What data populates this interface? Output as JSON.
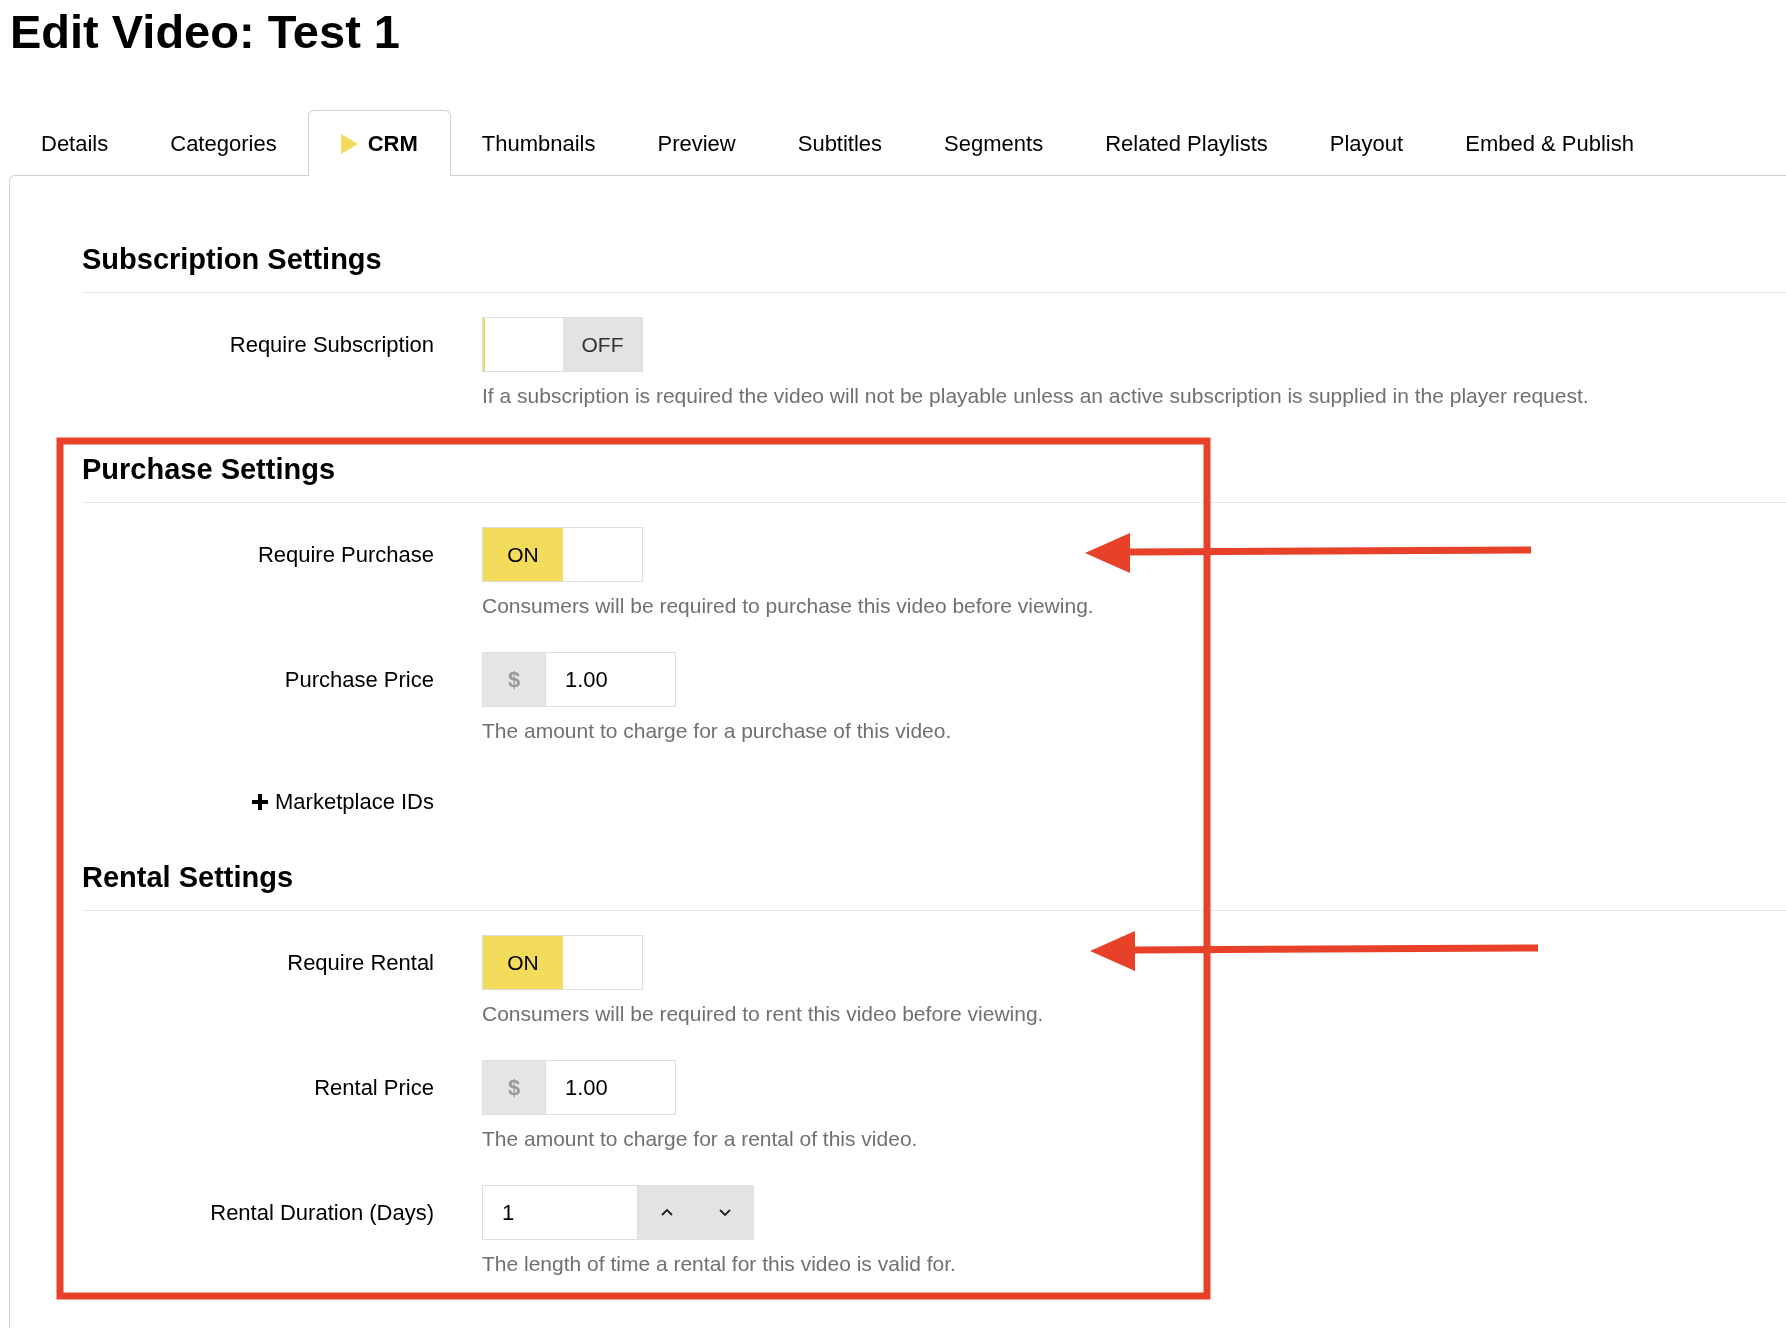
{
  "page_title": "Edit Video: Test 1",
  "tabs": [
    {
      "label": "Details",
      "selected": false
    },
    {
      "label": "Categories",
      "selected": false
    },
    {
      "label": "CRM",
      "selected": true
    },
    {
      "label": "Thumbnails",
      "selected": false
    },
    {
      "label": "Preview",
      "selected": false
    },
    {
      "label": "Subtitles",
      "selected": false
    },
    {
      "label": "Segments",
      "selected": false
    },
    {
      "label": "Related Playlists",
      "selected": false
    },
    {
      "label": "Playout",
      "selected": false
    },
    {
      "label": "Embed & Publish",
      "selected": false
    }
  ],
  "sections": [
    {
      "title": "Subscription Settings",
      "fields": [
        {
          "kind": "toggle",
          "label": "Require Subscription",
          "on": false,
          "state_text": "OFF",
          "help": "If a subscription is required the video will not be playable unless an active subscription is supplied in the player request."
        }
      ]
    },
    {
      "title": "Purchase Settings",
      "fields": [
        {
          "kind": "toggle",
          "label": "Require Purchase",
          "on": true,
          "state_text": "ON",
          "help": "Consumers will be required to purchase this video before viewing."
        },
        {
          "kind": "price",
          "label": "Purchase Price",
          "currency": "$",
          "value": "1.00",
          "help": "The amount to charge for a purchase of this video."
        },
        {
          "kind": "link",
          "label": "Marketplace IDs"
        }
      ]
    },
    {
      "title": "Rental Settings",
      "fields": [
        {
          "kind": "toggle",
          "label": "Require Rental",
          "on": true,
          "state_text": "ON",
          "help": "Consumers will be required to rent this video before viewing."
        },
        {
          "kind": "price",
          "label": "Rental Price",
          "currency": "$",
          "value": "1.00",
          "help": "The amount to charge for a rental of this video."
        },
        {
          "kind": "number",
          "label": "Rental Duration (Days)",
          "value": "1",
          "help": "The length of time a rental for this video is valid for."
        }
      ]
    }
  ]
}
